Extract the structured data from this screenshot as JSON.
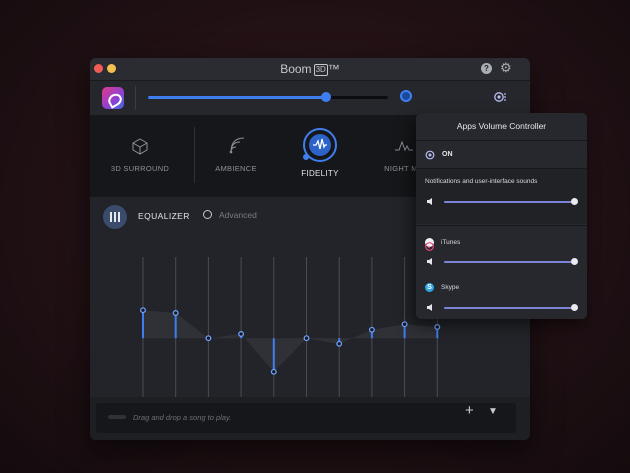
{
  "window": {
    "title": "Boom",
    "title_badge": "3D",
    "title_tm": "™",
    "master_volume": 0.74
  },
  "effects": [
    {
      "id": "3d-surround",
      "label": "3D SURROUND",
      "active": false
    },
    {
      "id": "ambience",
      "label": "AMBIENCE",
      "active": false
    },
    {
      "id": "fidelity",
      "label": "FIDELITY",
      "active": true
    },
    {
      "id": "night-mode",
      "label": "NIGHT MO",
      "active": false
    }
  ],
  "equalizer": {
    "label": "EQUALIZER",
    "advanced_label": "Advanced",
    "bands": [
      0.62,
      0.6,
      0.42,
      0.45,
      0.18,
      0.42,
      0.38,
      0.48,
      0.52,
      0.5
    ]
  },
  "footer": {
    "drop_text": "Drag and drop a song to play.",
    "add_label": "+",
    "menu_label": "▼"
  },
  "popup": {
    "title": "Apps Volume Controller",
    "on_label": "ON",
    "system_sounds_label": "Notifications and user-interface sounds",
    "system_sounds_level": 1.0,
    "apps": [
      {
        "name": "iTunes",
        "level": 1.0
      },
      {
        "name": "Skype",
        "level": 1.0
      }
    ]
  },
  "colors": {
    "accent": "#3f7ef0",
    "popup_slider": "#7c84d6"
  }
}
